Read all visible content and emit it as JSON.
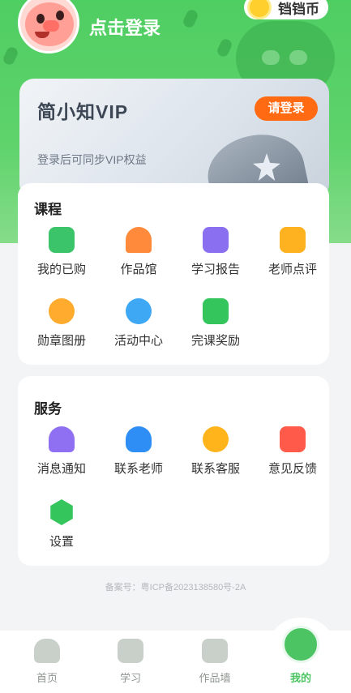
{
  "header": {
    "login_text": "点击登录",
    "coins_label": "铛铛币"
  },
  "vip": {
    "logo": "简小知VIP",
    "login_button": "请登录",
    "subtitle": "登录后可同步VIP权益"
  },
  "courses": {
    "title": "课程",
    "items": [
      {
        "label": "我的已购",
        "icon": "book-icon",
        "color": "#3cc46a"
      },
      {
        "label": "作品馆",
        "icon": "gallery-icon",
        "color": "#ff8a3c"
      },
      {
        "label": "学习报告",
        "icon": "report-icon",
        "color": "#8a70f0"
      },
      {
        "label": "老师点评",
        "icon": "comment-icon",
        "color": "#ffb21f"
      },
      {
        "label": "勋章图册",
        "icon": "medal-icon",
        "color": "#ffab2e"
      },
      {
        "label": "活动中心",
        "icon": "balloon-icon",
        "color": "#3fa8f5"
      },
      {
        "label": "完课奖励",
        "icon": "calendar-check-icon",
        "color": "#35c55d"
      }
    ]
  },
  "services": {
    "title": "服务",
    "items": [
      {
        "label": "消息通知",
        "icon": "bell-icon",
        "color": "#8f6ff2"
      },
      {
        "label": "联系老师",
        "icon": "teacher-icon",
        "color": "#2f8ef5"
      },
      {
        "label": "联系客服",
        "icon": "service-icon",
        "color": "#ffb41c"
      },
      {
        "label": "意见反馈",
        "icon": "feedback-icon",
        "color": "#ff5a4a"
      },
      {
        "label": "设置",
        "icon": "settings-icon",
        "color": "#35c55d"
      }
    ]
  },
  "icp": "备案号：粤ICP备2023138580号-2A",
  "nav": {
    "tabs": [
      {
        "label": "首页",
        "icon": "home-icon"
      },
      {
        "label": "学习",
        "icon": "play-icon"
      },
      {
        "label": "作品墙",
        "icon": "image-icon"
      },
      {
        "label": "我的",
        "icon": "pig-icon"
      }
    ],
    "active_index": 3
  },
  "colors": {
    "brand_green": "#4cc463",
    "vip_button": "#ff6a13"
  }
}
